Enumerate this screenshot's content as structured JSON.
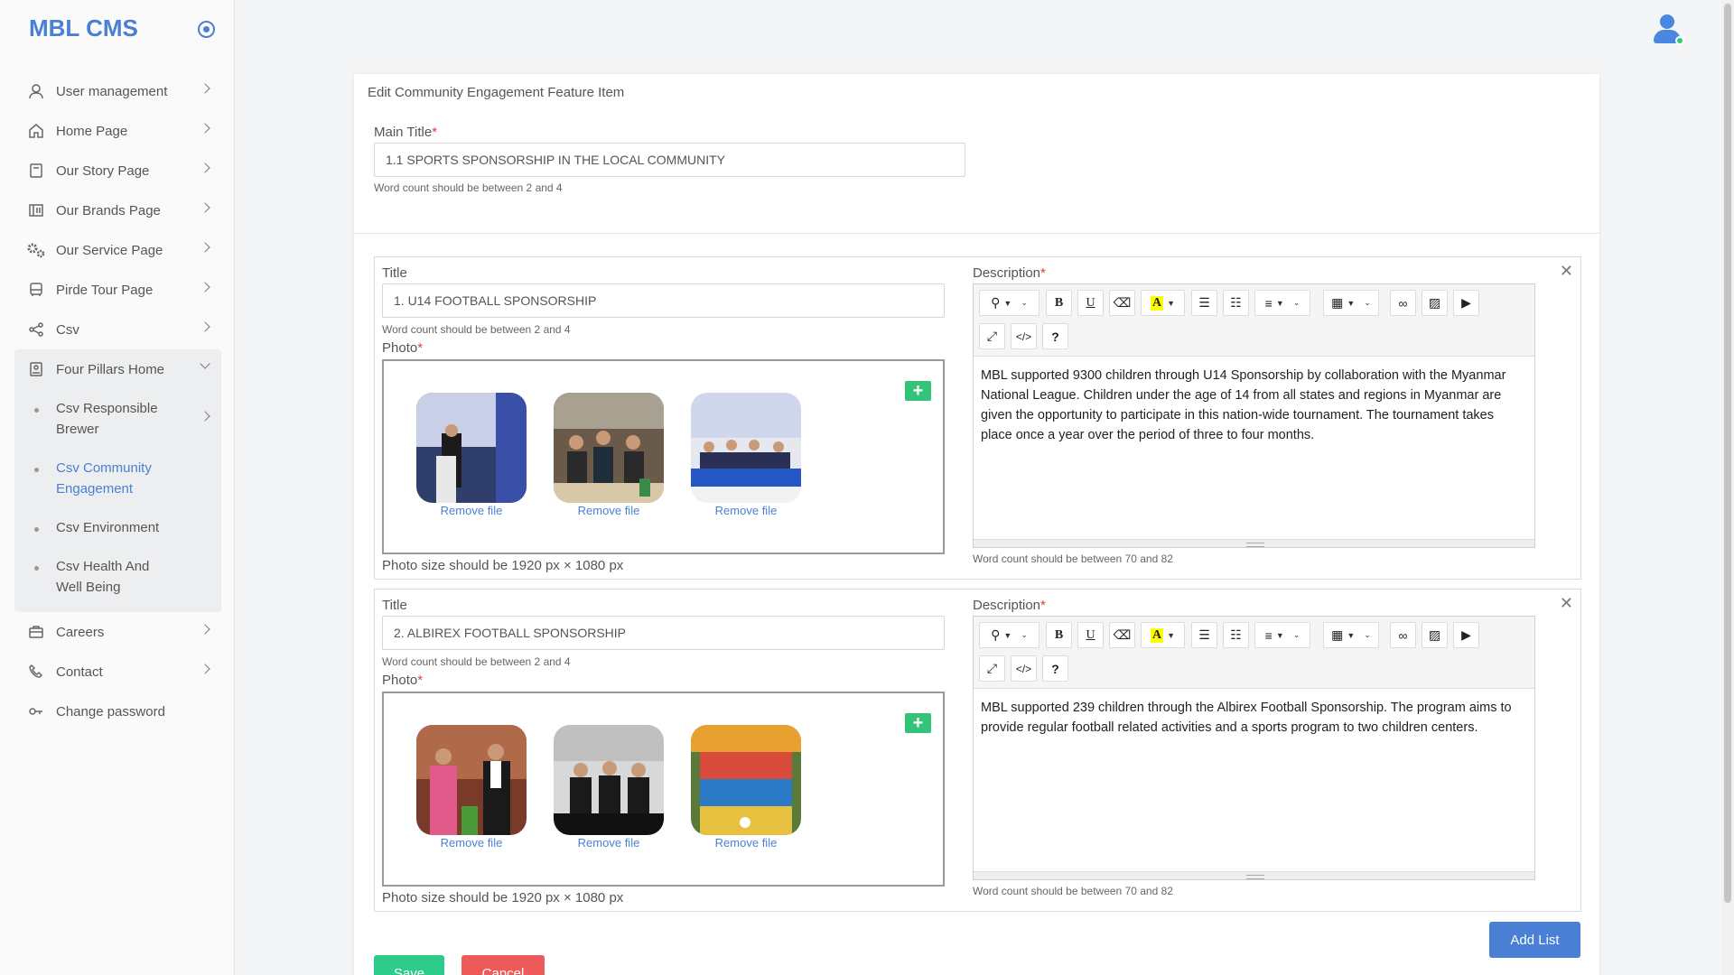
{
  "app": {
    "brand": "MBL CMS"
  },
  "sidebar": {
    "items": [
      {
        "label": "User management",
        "icon": "user-icon"
      },
      {
        "label": "Home Page",
        "icon": "home-icon"
      },
      {
        "label": "Our Story Page",
        "icon": "book-icon"
      },
      {
        "label": "Our Brands Page",
        "icon": "brands-icon"
      },
      {
        "label": "Our Service Page",
        "icon": "gears-icon"
      },
      {
        "label": "Pirde Tour Page",
        "icon": "bus-icon"
      },
      {
        "label": "Csv",
        "icon": "share-icon"
      },
      {
        "label": "Four Pillars Home",
        "icon": "pillars-icon"
      }
    ],
    "subitems": [
      {
        "label": "Csv Responsible Brewer"
      },
      {
        "label": "Csv Community Engagement"
      },
      {
        "label": "Csv Environment"
      },
      {
        "label": "Csv Health And Well Being"
      }
    ],
    "bottom_items": [
      {
        "label": "Careers",
        "icon": "briefcase-icon"
      },
      {
        "label": "Contact",
        "icon": "phone-icon"
      },
      {
        "label": "Change password",
        "icon": "key-icon"
      }
    ]
  },
  "page": {
    "card_title": "Edit Community Engagement Feature Item",
    "main_title_label": "Main Title",
    "required_mark": "*",
    "main_title_value": "1.1 SPORTS SPONSORSHIP IN THE LOCAL COMMUNITY",
    "main_title_hint": "Word count should be between 2 and 4"
  },
  "blocks": [
    {
      "title_label": "Title",
      "title_value": "1. U14 FOOTBALL SPONSORSHIP",
      "title_hint": "Word count should be between 2 and 4",
      "photo_label": "Photo",
      "remove_label": "Remove file",
      "photo_hint": "Photo size should be 1920 px × 1080 px",
      "desc_label": "Description",
      "description": "MBL supported 9300 children through U14 Sponsorship by collaboration with the Myanmar National League. Children under the age of 14 from all states and regions in Myanmar are given the opportunity to participate in this nation-wide tournament. The tournament takes place once a year over the period of three to four months.",
      "desc_hint": "Word count should be between 70 and 82"
    },
    {
      "title_label": "Title",
      "title_value": "2. ALBIREX FOOTBALL SPONSORSHIP",
      "title_hint": "Word count should be between 2 and 4",
      "photo_label": "Photo",
      "remove_label": "Remove file",
      "photo_hint": "Photo size should be 1920 px × 1080 px",
      "desc_label": "Description",
      "description": "MBL supported 239 children through the Albirex Football Sponsorship. The program aims to provide regular football related activities and a sports program to two children centers.",
      "desc_hint": "Word count should be between 70 and 82"
    }
  ],
  "toolbar": {
    "bold": "B",
    "underline": "U",
    "font_color": "A",
    "codeview": "</>",
    "help": "?"
  },
  "actions": {
    "add_list": "Add List",
    "save": "Save",
    "cancel": "Cancel"
  },
  "colors": {
    "accent": "#4a7fd6",
    "add_green": "#33c47a",
    "save": "#2ecc8a",
    "cancel": "#ee5a5a"
  }
}
